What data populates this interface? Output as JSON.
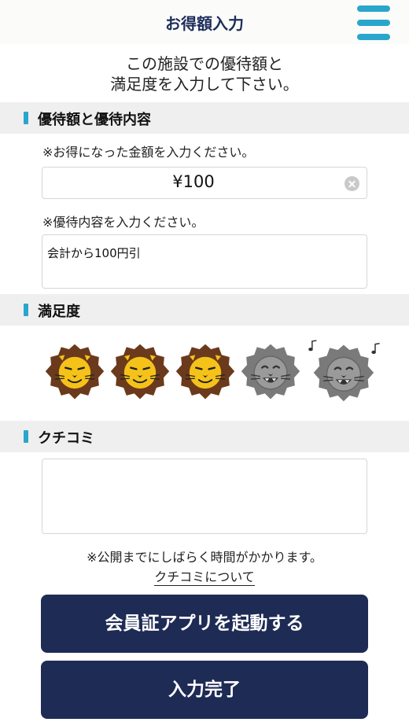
{
  "header": {
    "title": "お得額入力",
    "menu_icon": "hamburger-menu-icon"
  },
  "intro": {
    "line1": "この施設での優待額と",
    "line2": "満足度を入力して下さい。"
  },
  "benefit": {
    "heading": "優待額と優待内容",
    "amount_note": "※お得になった金額を入力ください。",
    "amount_value": "¥100",
    "detail_note": "※優待内容を入力ください。",
    "detail_value": "会計から100円引"
  },
  "satisfaction": {
    "heading": "満足度",
    "rating": 3,
    "max": 5
  },
  "review": {
    "heading": "クチコミ",
    "value": "",
    "disclaimer": "※公開までにしばらく時間がかかります。",
    "link_label": "クチコミについて"
  },
  "buttons": {
    "launch_app": "会員証アプリを起動する",
    "complete": "入力完了"
  },
  "colors": {
    "accent": "#2aa6cc",
    "navy": "#1e2b55",
    "lion_active": "#f5c21a",
    "lion_mane": "#6b3a1c",
    "lion_inactive": "#8e8e8e"
  }
}
